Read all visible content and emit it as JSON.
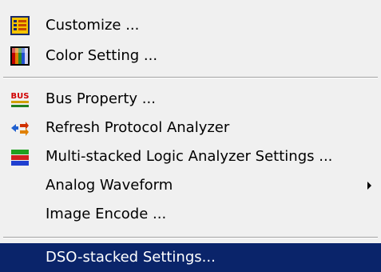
{
  "menu": {
    "items": [
      {
        "label": "Customize ...",
        "icon": "customize-list-icon"
      },
      {
        "label": "Color Setting ...",
        "icon": "color-palette-icon"
      },
      {
        "label": "Bus Property ...",
        "icon": "bus-icon"
      },
      {
        "label": "Refresh Protocol Analyzer",
        "icon": "refresh-protocol-icon"
      },
      {
        "label": "Multi-stacked Logic Analyzer Settings ...",
        "icon": "multi-stacked-icon"
      },
      {
        "label": "Analog Waveform",
        "has_submenu": true
      },
      {
        "label": "Image Encode ..."
      },
      {
        "label": "DSO-stacked Settings...",
        "highlighted": true
      }
    ]
  },
  "colors": {
    "menu_background": "#f0f0f0",
    "highlight_background": "#0a246a",
    "highlight_text": "#ffffff"
  },
  "icons": {
    "bus_text": "BUS"
  }
}
